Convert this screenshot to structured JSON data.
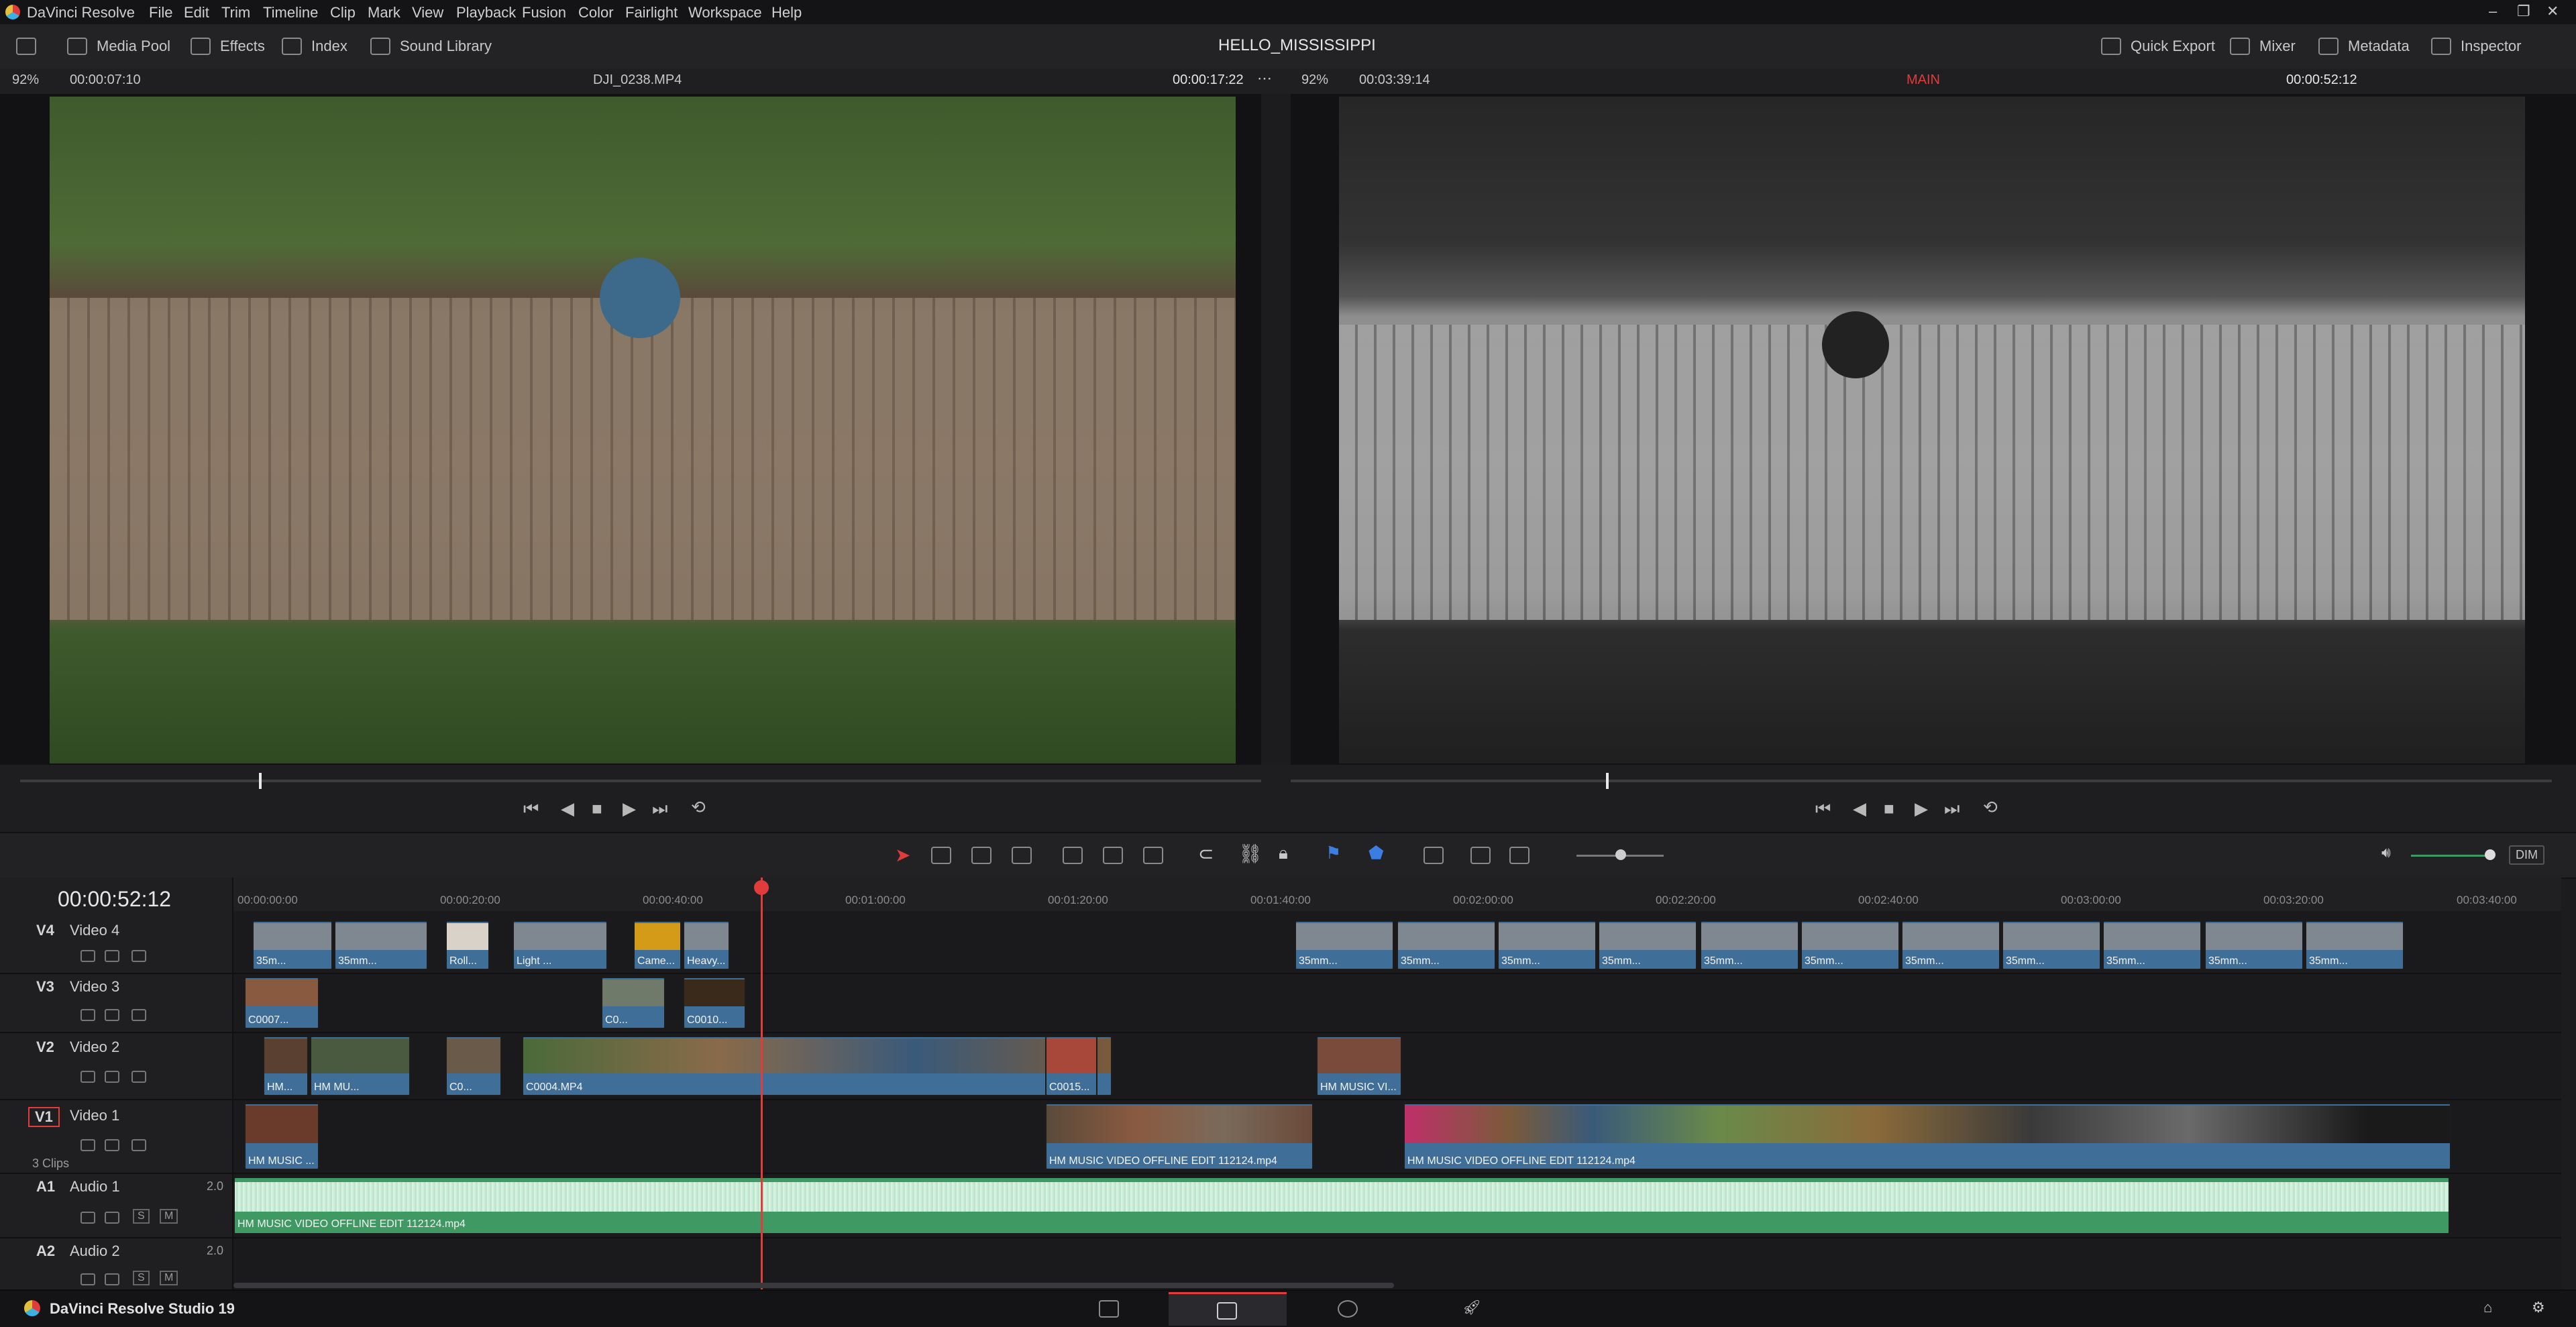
{
  "app": {
    "name": "DaVinci Resolve",
    "footer_name": "DaVinci Resolve Studio 19",
    "project_title": "HELLO_MISSISSIPPI"
  },
  "menu": [
    "File",
    "Edit",
    "Trim",
    "Timeline",
    "Clip",
    "Mark",
    "View",
    "Playback",
    "Fusion",
    "Color",
    "Fairlight",
    "Workspace",
    "Help"
  ],
  "toolbar": {
    "left": [
      "Media Pool",
      "Effects",
      "Index",
      "Sound Library"
    ],
    "right": [
      "Quick Export",
      "Mixer",
      "Metadata",
      "Inspector"
    ]
  },
  "source_viewer": {
    "zoom": "92%",
    "duration": "00:00:07:10",
    "clip_name": "DJI_0238.MP4",
    "timecode": "00:00:17:22"
  },
  "timeline_viewer": {
    "zoom": "92%",
    "duration": "00:03:39:14",
    "timeline_name": "MAIN",
    "timecode": "00:00:52:12"
  },
  "timeline": {
    "timecode": "00:00:52:12",
    "ruler": [
      "00:00:00:00",
      "00:00:20:00",
      "00:00:40:00",
      "00:01:00:00",
      "00:01:20:00",
      "00:01:40:00",
      "00:02:00:00",
      "00:02:20:00",
      "00:02:40:00",
      "00:03:00:00",
      "00:03:20:00",
      "00:03:40:00"
    ],
    "dim_label": "DIM",
    "clip_count": "3 Clips",
    "tracks": [
      {
        "id": "V4",
        "name": "Video 4"
      },
      {
        "id": "V3",
        "name": "Video 3"
      },
      {
        "id": "V2",
        "name": "Video 2"
      },
      {
        "id": "V1",
        "name": "Video 1"
      },
      {
        "id": "A1",
        "name": "Audio 1",
        "level": "2.0"
      },
      {
        "id": "A2",
        "name": "Audio 2",
        "level": "2.0"
      }
    ],
    "clip_labels": {
      "v4": [
        "35m...",
        "35mm...",
        "Roll...",
        "Light ...",
        "Came...",
        "Heavy...",
        "35mm...",
        "35mm...",
        "35mm...",
        "35mm...",
        "35mm...",
        "35mm...",
        "35mm...",
        "35mm...",
        "35mm...",
        "35mm...",
        "35mm..."
      ],
      "v3": [
        "C0007...",
        "C0...",
        "C0010..."
      ],
      "v2": [
        "HM...",
        "HM MU...",
        "C0...",
        "C0004.MP4",
        "C0015...",
        "HM MUSIC VI..."
      ],
      "v1": [
        "HM MUSIC ...",
        "HM MUSIC VIDEO OFFLINE EDIT 112124.mp4",
        "HM MUSIC VIDEO OFFLINE EDIT 112124.mp4"
      ],
      "a1": "HM MUSIC VIDEO OFFLINE EDIT 112124.mp4"
    },
    "solo_label": "S",
    "mute_label": "M"
  },
  "colors": {
    "accent_red": "#e23b3b",
    "clip_blue": "#3f6f98",
    "audio_green": "#3e9a62"
  }
}
